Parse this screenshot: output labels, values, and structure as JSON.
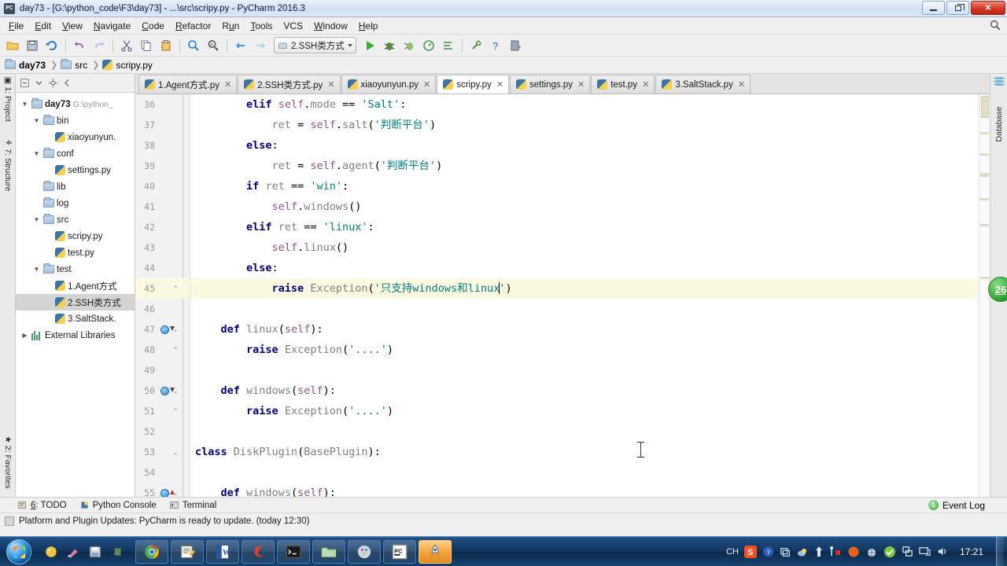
{
  "window": {
    "title": "day73 - [G:\\python_code\\F3\\day73] - ...\\src\\scripy.py - PyCharm 2016.3",
    "app_icon": "pycharm-icon",
    "minimize": "minimize-button",
    "restore": "restore-button",
    "close": "close-button"
  },
  "menu": {
    "items": [
      {
        "label": "File"
      },
      {
        "label": "Edit"
      },
      {
        "label": "View"
      },
      {
        "label": "Navigate"
      },
      {
        "label": "Code"
      },
      {
        "label": "Refactor"
      },
      {
        "label": "Run"
      },
      {
        "label": "Tools"
      },
      {
        "label": "VCS"
      },
      {
        "label": "Window"
      },
      {
        "label": "Help"
      }
    ]
  },
  "toolbar": {
    "run_config": "2.SSH类方式",
    "buttons": [
      "open-folder-icon",
      "save-all-icon",
      "sync-icon",
      "undo-icon",
      "redo-icon",
      "cut-icon",
      "copy-icon",
      "paste-icon",
      "find-icon",
      "replace-icon",
      "back-icon",
      "forward-icon"
    ],
    "run_buttons": [
      "run-icon",
      "debug-icon",
      "coverage-icon",
      "profile-icon",
      "run-with-console-icon",
      "settings-icon",
      "help-icon",
      "update-icon"
    ]
  },
  "breadcrumb": {
    "items": [
      {
        "label": "day73",
        "icon": "folder-icon"
      },
      {
        "label": "src",
        "icon": "folder-icon"
      },
      {
        "label": "scripy.py",
        "icon": "python-file-icon"
      }
    ]
  },
  "left_strip": {
    "project": "1: Project",
    "structure": "7: Structure",
    "favorites": "2: Favorites"
  },
  "right_strip": {
    "database": "Database",
    "badge": "26"
  },
  "project": {
    "header_icons": [
      "collapse-all-icon",
      "expand-icon",
      "settings-icon",
      "hide-icon"
    ],
    "tree": [
      {
        "label": "day73",
        "path": "G:\\python_",
        "depth": 0,
        "icon": "folder-icon",
        "arrow": "▼",
        "bold": true,
        "selected": false
      },
      {
        "label": "bin",
        "path": "",
        "depth": 1,
        "icon": "folder-icon",
        "arrow": "▼",
        "bold": false,
        "selected": false
      },
      {
        "label": "xiaoyunyun.",
        "path": "",
        "depth": 2,
        "icon": "python-file-icon",
        "arrow": "",
        "bold": false,
        "selected": false
      },
      {
        "label": "conf",
        "path": "",
        "depth": 1,
        "icon": "folder-icon",
        "arrow": "▼",
        "bold": false,
        "selected": false
      },
      {
        "label": "settings.py",
        "path": "",
        "depth": 2,
        "icon": "python-file-icon",
        "arrow": "",
        "bold": false,
        "selected": false
      },
      {
        "label": "lib",
        "path": "",
        "depth": 1,
        "icon": "folder-icon",
        "arrow": "",
        "bold": false,
        "selected": false
      },
      {
        "label": "log",
        "path": "",
        "depth": 1,
        "icon": "folder-icon",
        "arrow": "",
        "bold": false,
        "selected": false
      },
      {
        "label": "src",
        "path": "",
        "depth": 1,
        "icon": "folder-icon",
        "arrow": "▼",
        "bold": false,
        "selected": false
      },
      {
        "label": "scripy.py",
        "path": "",
        "depth": 2,
        "icon": "python-file-icon",
        "arrow": "",
        "bold": false,
        "selected": false
      },
      {
        "label": "test.py",
        "path": "",
        "depth": 2,
        "icon": "python-file-icon",
        "arrow": "",
        "bold": false,
        "selected": false
      },
      {
        "label": "test",
        "path": "",
        "depth": 1,
        "icon": "folder-icon",
        "arrow": "▼",
        "bold": false,
        "selected": false
      },
      {
        "label": "1.Agent方式",
        "path": "",
        "depth": 2,
        "icon": "python-file-icon",
        "arrow": "",
        "bold": false,
        "selected": false
      },
      {
        "label": "2.SSH类方式",
        "path": "",
        "depth": 2,
        "icon": "python-file-icon",
        "arrow": "",
        "bold": false,
        "selected": true
      },
      {
        "label": "3.SaltStack.",
        "path": "",
        "depth": 2,
        "icon": "python-file-icon",
        "arrow": "",
        "bold": false,
        "selected": false
      },
      {
        "label": "External Libraries",
        "path": "",
        "depth": 0,
        "icon": "library-icon",
        "arrow": "▶",
        "bold": false,
        "selected": false
      }
    ]
  },
  "tabs": [
    {
      "label": "1.Agent方式.py",
      "active": false
    },
    {
      "label": "2.SSH类方式.py",
      "active": false
    },
    {
      "label": "xiaoyunyun.py",
      "active": false
    },
    {
      "label": "scripy.py",
      "active": true
    },
    {
      "label": "settings.py",
      "active": false
    },
    {
      "label": "test.py",
      "active": false
    },
    {
      "label": "3.SaltStack.py",
      "active": false
    }
  ],
  "editor": {
    "lines": [
      {
        "num": "36",
        "text": "        elif self.mode == 'Salt':",
        "highlighted": false,
        "marker": "",
        "fold": ""
      },
      {
        "num": "37",
        "text": "            ret = self.salt('判断平台')",
        "highlighted": false,
        "marker": "",
        "fold": ""
      },
      {
        "num": "38",
        "text": "        else:",
        "highlighted": false,
        "marker": "",
        "fold": ""
      },
      {
        "num": "39",
        "text": "            ret = self.agent('判断平台')",
        "highlighted": false,
        "marker": "",
        "fold": ""
      },
      {
        "num": "40",
        "text": "        if ret == 'win':",
        "highlighted": false,
        "marker": "",
        "fold": ""
      },
      {
        "num": "41",
        "text": "            self.windows()",
        "highlighted": false,
        "marker": "",
        "fold": ""
      },
      {
        "num": "42",
        "text": "        elif ret == 'linux':",
        "highlighted": false,
        "marker": "",
        "fold": ""
      },
      {
        "num": "43",
        "text": "            self.linux()",
        "highlighted": false,
        "marker": "",
        "fold": ""
      },
      {
        "num": "44",
        "text": "        else:",
        "highlighted": false,
        "marker": "",
        "fold": ""
      },
      {
        "num": "45",
        "text": "            raise Exception('只支持windows和linux')",
        "highlighted": true,
        "marker": "",
        "fold": "end"
      },
      {
        "num": "46",
        "text": "",
        "highlighted": false,
        "marker": "",
        "fold": ""
      },
      {
        "num": "47",
        "text": "    def linux(self):",
        "highlighted": false,
        "marker": "override-down",
        "fold": "start"
      },
      {
        "num": "48",
        "text": "        raise Exception('....')",
        "highlighted": false,
        "marker": "",
        "fold": "end"
      },
      {
        "num": "49",
        "text": "",
        "highlighted": false,
        "marker": "",
        "fold": ""
      },
      {
        "num": "50",
        "text": "    def windows(self):",
        "highlighted": false,
        "marker": "override-down",
        "fold": "start"
      },
      {
        "num": "51",
        "text": "        raise Exception('....')",
        "highlighted": false,
        "marker": "",
        "fold": "end"
      },
      {
        "num": "52",
        "text": "",
        "highlighted": false,
        "marker": "",
        "fold": ""
      },
      {
        "num": "53",
        "text": "class DiskPlugin(BasePlugin):",
        "highlighted": false,
        "marker": "",
        "fold": "start"
      },
      {
        "num": "54",
        "text": "",
        "highlighted": false,
        "marker": "",
        "fold": ""
      },
      {
        "num": "55",
        "text": "    def windows(self):",
        "highlighted": false,
        "marker": "override-up",
        "fold": "start"
      }
    ]
  },
  "status": {
    "todo": "6: TODO",
    "python_console": "Python Console",
    "terminal": "Terminal",
    "event_log": "Event Log",
    "event_count": "1",
    "notification": "Platform and Plugin Updates: PyCharm is ready to update. (today 12:30)"
  },
  "taskbar": {
    "start": "start-button",
    "quick_launch": [
      "palette-icon",
      "paint-brush-icon",
      "floppy-save-icon",
      "plug-icon"
    ],
    "tasks": [
      {
        "icon": "chrome-icon",
        "active": false
      },
      {
        "icon": "notepad-icon",
        "active": false
      },
      {
        "icon": "word-icon",
        "active": false
      },
      {
        "icon": "sogou-icon",
        "active": false
      },
      {
        "icon": "cmd-icon",
        "active": false
      },
      {
        "icon": "explorer-icon",
        "active": false
      },
      {
        "icon": "palette-app-icon",
        "active": false
      },
      {
        "icon": "pycharm-taskbar-icon",
        "active": false
      },
      {
        "icon": "rocket-icon",
        "active": true
      }
    ],
    "tray": [
      "ime-ch",
      "sogou-s-icon",
      "help-icon",
      "window-icon",
      "cloud-icon",
      "arrow-up-icon",
      "tools-icon",
      "orange-dot-icon",
      "globe-icon",
      "shield-icon",
      "network-icon",
      "monitor-icon",
      "volume-icon"
    ],
    "ime_label": "CH",
    "clock": "17:21"
  }
}
